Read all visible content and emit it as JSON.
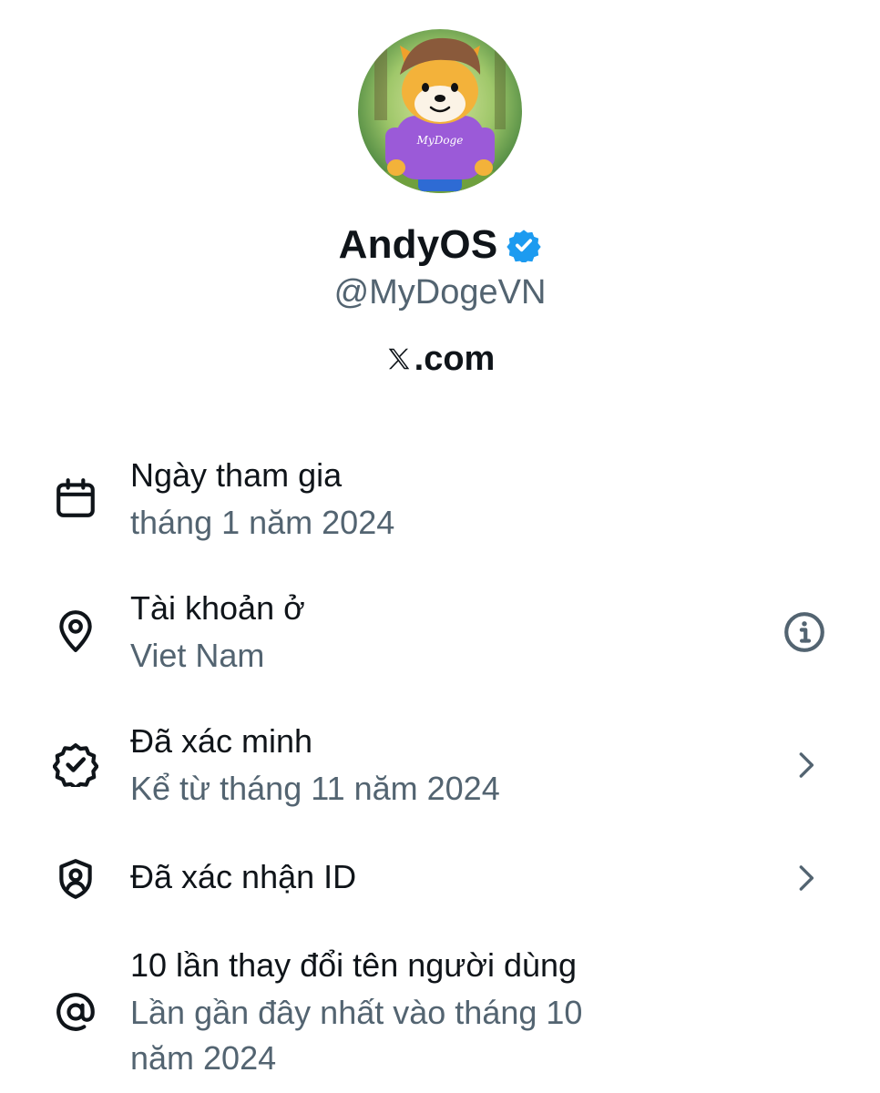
{
  "profile": {
    "avatar_text": "MyDoge",
    "display_name": "AndyOS",
    "handle": "@MyDogeVN",
    "platform_domain": ".com",
    "verified_icon": "verified-badge-icon",
    "accent_color": "#1d9bf0"
  },
  "details": [
    {
      "icon": "calendar-icon",
      "title": "Ngày tham gia",
      "subtitle": "tháng 1 năm 2024"
    },
    {
      "icon": "location-pin-icon",
      "title": "Tài khoản ở",
      "subtitle": "Viet Nam",
      "action_icon": "info-icon"
    },
    {
      "icon": "verified-outline-icon",
      "title": "Đã xác minh",
      "subtitle": "Kể từ tháng 11 năm 2024",
      "action_icon": "chevron-right-icon"
    },
    {
      "icon": "shield-person-icon",
      "title": "Đã xác nhận ID",
      "action_icon": "chevron-right-icon"
    },
    {
      "icon": "at-sign-icon",
      "title": "10 lần thay đổi tên người dùng",
      "subtitle_line1": "Lần gần đây nhất vào tháng 10",
      "subtitle_line2": "năm 2024"
    }
  ]
}
